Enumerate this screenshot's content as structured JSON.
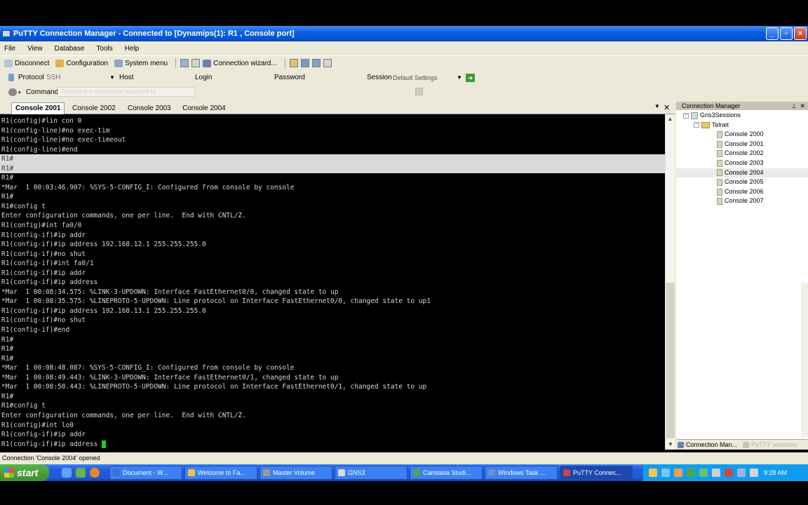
{
  "window": {
    "title": "PuTTY Connection Manager - Connected to [Dynamips(1): R1 , Console port]"
  },
  "menu": [
    "File",
    "View",
    "Database",
    "Tools",
    "Help"
  ],
  "toolbar": {
    "disconnect": "Disconnect",
    "configuration": "Configuration",
    "system_menu": "System menu",
    "connection_wizard": "Connection wizard..."
  },
  "connection_bar": {
    "protocol_label": "Protocol",
    "protocol_value": "SSH",
    "host_label": "Host",
    "login_label": "Login",
    "password_label": "Password",
    "session_label": "Session",
    "session_value": "Default Settings",
    "command_label": "Command",
    "command_placeholder": "Command or commands separated by ..."
  },
  "tabs": [
    "Console 2001",
    "Console 2002",
    "Console 2003",
    "Console 2004"
  ],
  "terminal": {
    "lines": [
      "R1(config)#lin con 0",
      "R1(config-line)#no exec-tim",
      "R1(config-line)#no exec-timeout",
      "R1(config-line)#end",
      "R1#",
      "R1#",
      "R1#",
      "*Mar  1 00:03:46.907: %SYS-5-CONFIG_I: Configured from console by console",
      "R1#",
      "R1#config t",
      "Enter configuration commands, one per line.  End with CNTL/Z.",
      "R1(config)#int fa0/0",
      "R1(config-if)#ip addr",
      "R1(config-if)#ip address 192.168.12.1 255.255.255.0",
      "R1(config-if)#no shut",
      "R1(config-if)#int fa0/1",
      "R1(config-if)#ip addr",
      "R1(config-if)#ip address",
      "*Mar  1 00:08:34.575: %LINK-3-UPDOWN: Interface FastEthernet0/0, changed state to up",
      "*Mar  1 00:08:35.575: %LINEPROTO-5-UPDOWN: Line protocol on Interface FastEthernet0/0, changed state to up1",
      "R1(config-if)#ip address 192.168.13.1 255.255.255.0",
      "R1(config-if)#no shut",
      "R1(config-if)#end",
      "R1#",
      "R1#",
      "R1#",
      "*Mar  1 00:08:48.087: %SYS-5-CONFIG_I: Configured from console by console",
      "*Mar  1 00:08:49.443: %LINK-3-UPDOWN: Interface FastEthernet0/1, changed state to up",
      "*Mar  1 00:08:50.443: %LINEPROTO-5-UPDOWN: Line protocol on Interface FastEthernet0/1, changed state to up",
      "R1#",
      "R1#config t",
      "Enter configuration commands, one per line.  End with CNTL/Z.",
      "R1(config)#int lo0",
      "R1(config-if)#ip addr",
      "R1(config-if)#ip address "
    ]
  },
  "connection_manager": {
    "title": "Connection Manager",
    "root": "Gns3Sessions",
    "folder": "Telnet",
    "items": [
      "Console 2000",
      "Console 2001",
      "Console 2002",
      "Console 2003",
      "Console 2004",
      "Console 2005",
      "Console 2006",
      "Console 2007"
    ],
    "bottom_tabs": [
      "Connection Man...",
      "PuTTY sessions"
    ]
  },
  "status": {
    "text": "Connection 'Console 2004' opened"
  },
  "taskbar": {
    "start": "start",
    "tasks": [
      "Document - W...",
      "Welcome to Fa...",
      "Master Volume",
      "GNS3",
      "Camtasia Studi...",
      "Windows Task ...",
      "PuTTY Connec..."
    ],
    "clock": "9:28 AM"
  },
  "colors": {
    "accent": "#0a5ee0",
    "terminal_bg": "#000000",
    "cursor": "#22cc22"
  }
}
